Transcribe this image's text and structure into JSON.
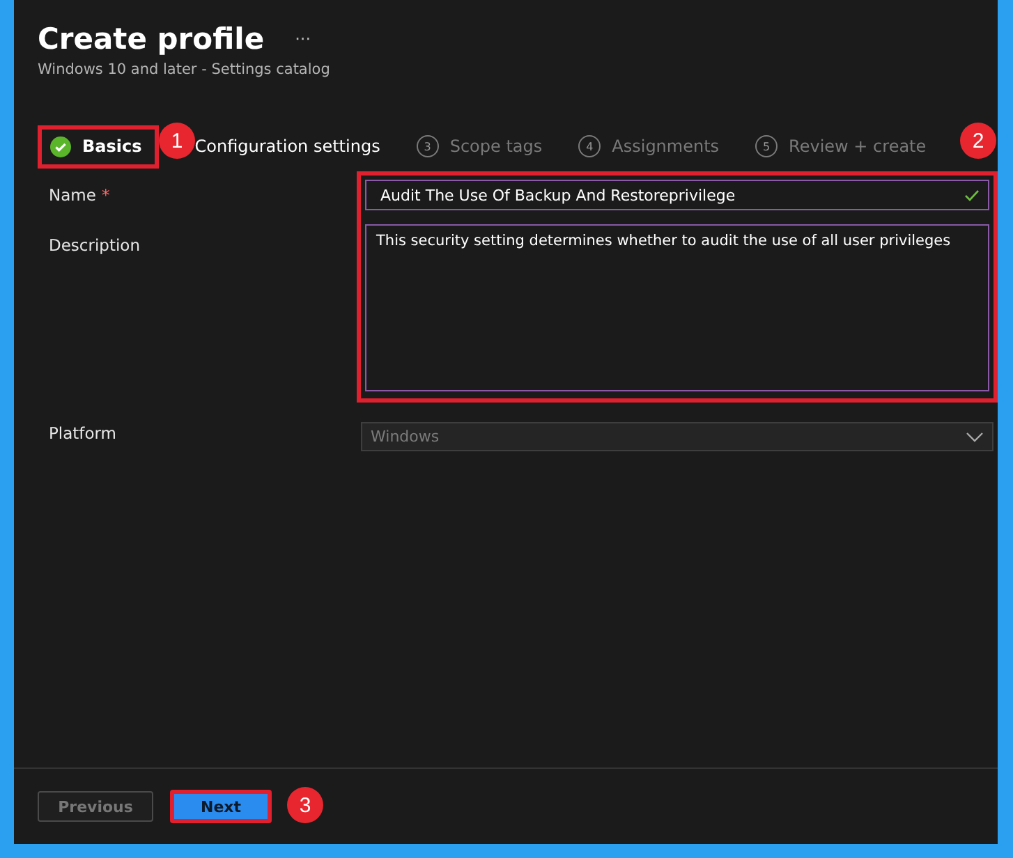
{
  "header": {
    "title": "Create profile",
    "more": "···",
    "subtitle": "Windows 10 and later - Settings catalog"
  },
  "steps": [
    {
      "kind": "done",
      "label": "Basics",
      "selected": true
    },
    {
      "kind": "active",
      "label": "Configuration settings",
      "selected": false
    },
    {
      "kind": "upcoming",
      "label": "Scope tags",
      "number": "3",
      "selected": false
    },
    {
      "kind": "upcoming",
      "label": "Assignments",
      "number": "4",
      "selected": false
    },
    {
      "kind": "upcoming",
      "label": "Review + create",
      "number": "5",
      "selected": false
    }
  ],
  "form": {
    "name": {
      "label": "Name",
      "required_mark": "*",
      "value": "Audit The Use Of Backup And Restoreprivilege",
      "valid": true
    },
    "description": {
      "label": "Description",
      "value": "This security setting determines whether to audit the use of all user privileges"
    },
    "platform": {
      "label": "Platform",
      "value": "Windows",
      "disabled": true
    }
  },
  "footer": {
    "buttons": [
      {
        "label": "Previous",
        "disabled": true
      },
      {
        "label": "Next",
        "disabled": false
      }
    ]
  },
  "annotations": [
    "1",
    "2",
    "3"
  ]
}
